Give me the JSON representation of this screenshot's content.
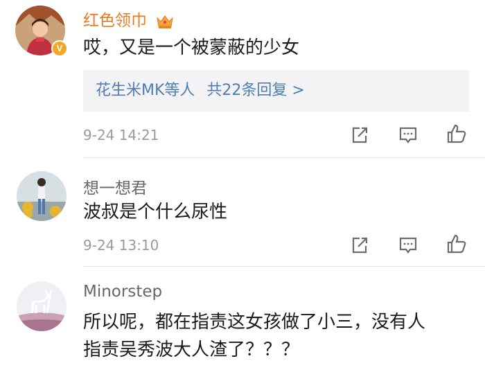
{
  "comments": [
    {
      "username": "红色领巾",
      "text": "哎，又是一个被蒙蔽的少女",
      "replies": {
        "names": "花生米MK等人",
        "count_text": "共22条回复 >"
      },
      "timestamp": "9-24 14:21",
      "verified_badge": "V",
      "avatar_icon": "avatar-icon",
      "username_color": "#ea7a22"
    },
    {
      "username": "想一想君",
      "text": "波叔是个什么尿性",
      "timestamp": "9-24 13:10",
      "avatar_icon": "avatar-icon"
    },
    {
      "username": "Minorstep",
      "text_line1": "所以呢，都在指责这女孩做了小三，没有人",
      "text_line2": "指责吴秀波大人渣了？？？",
      "avatar_icon": "avatar-icon"
    }
  ],
  "actions": [
    "share-icon",
    "comment-icon",
    "like-icon"
  ],
  "colors": {
    "link": "#507daf",
    "username_vip": "#ea7a22",
    "meta": "#9a9a9a",
    "reply_bg": "#f3f3f5"
  }
}
